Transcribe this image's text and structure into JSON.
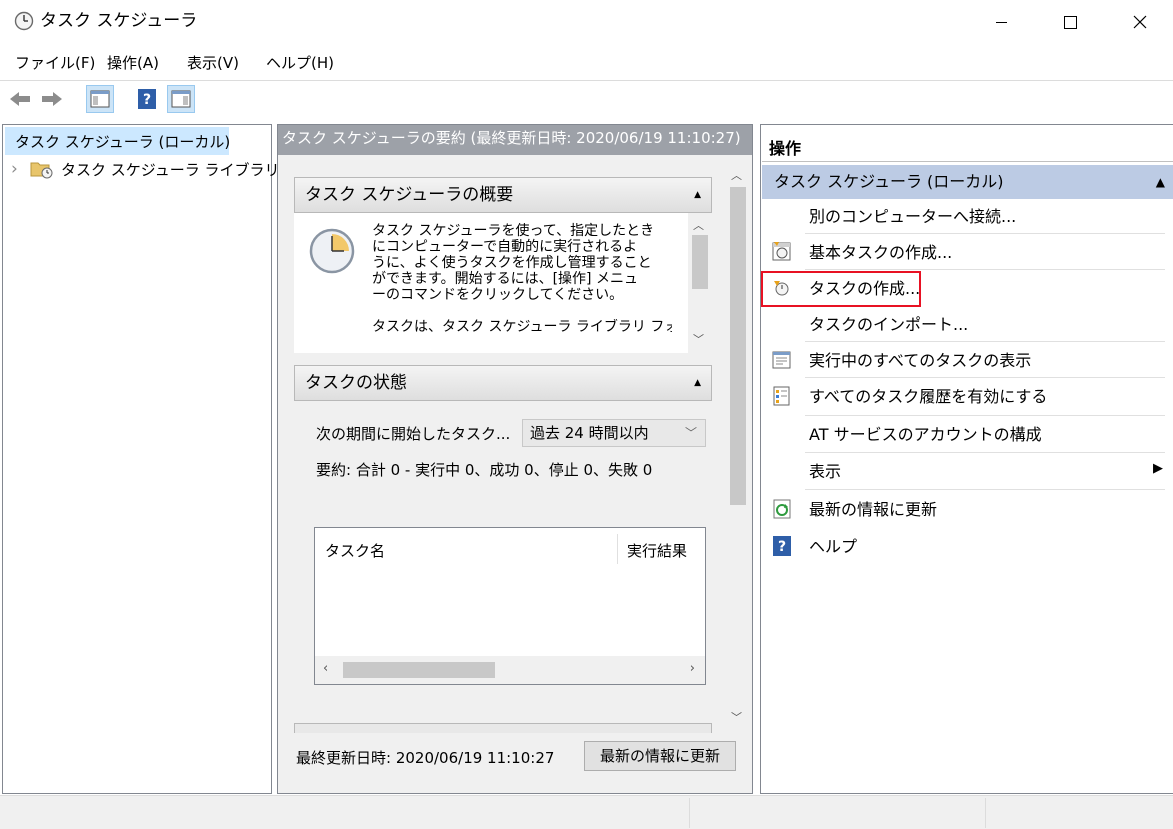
{
  "window": {
    "title": "タスク スケジューラ",
    "minimize_glyph": "─",
    "maximize_glyph": "☐",
    "close_glyph": "✕"
  },
  "menu": [
    "ファイル(F)",
    "操作(A)",
    "表示(V)",
    "ヘルプ(H)"
  ],
  "tree": {
    "root": "タスク スケジューラ (ローカル)",
    "library": "タスク スケジューラ ライブラリ",
    "expander": "›"
  },
  "center": {
    "header": "タスク スケジューラの要約 (最終更新日時: 2020/06/19 11:10:27)",
    "overview": {
      "title": "タスク スケジューラの概要",
      "line1": "タスク スケジューラを使って、指定したとき",
      "line2": "にコンピューターで自動的に実行されるよ",
      "line3": "うに、よく使うタスクを作成し管理すること",
      "line4": "ができます。開始するには、[操作] メニュ",
      "line5": "ーのコマンドをクリックしてください。",
      "line6": "タスクは、タスク スケジューラ ライブラリ フォ"
    },
    "status": {
      "title": "タスクの状態",
      "period_label": "次の期間に開始したタスク...",
      "period_value": "過去 24 時間以内",
      "summary": "要約: 合計 0 - 実行中 0、成功 0、停止 0、失敗 0",
      "col_name": "タスク名",
      "col_result": "実行結果"
    },
    "last_updated": "最終更新日時: 2020/06/19 11:10:27",
    "refresh_button": "最新の情報に更新"
  },
  "actions": {
    "title": "操作",
    "section": "タスク スケジューラ (ローカル)",
    "items": [
      "別のコンピューターへ接続...",
      "基本タスクの作成...",
      "タスクの作成...",
      "タスクのインポート...",
      "実行中のすべてのタスクの表示",
      "すべてのタスク履歴を有効にする",
      "AT サービスのアカウントの構成",
      "表示",
      "最新の情報に更新",
      "ヘルプ"
    ]
  },
  "colors": {
    "highlight": "#e81123",
    "section_blue": "#bccbe4",
    "header_gray": "#9da1a8"
  }
}
